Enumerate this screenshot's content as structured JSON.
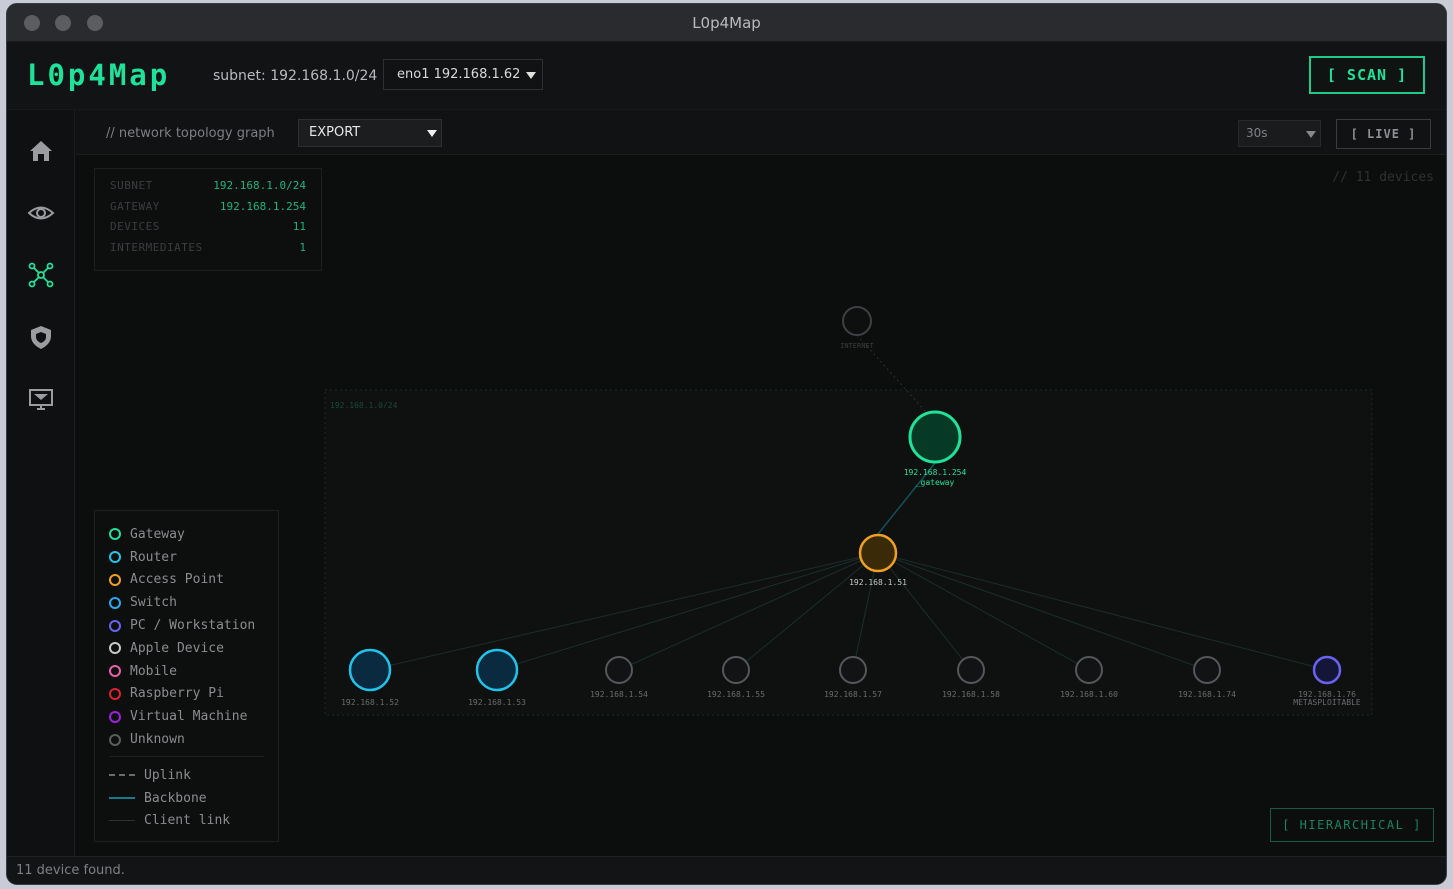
{
  "window": {
    "title": "L0p4Map"
  },
  "header": {
    "logo": "L0p4Map",
    "subnet_label": "subnet: 192.168.1.0/24",
    "interface": "eno1 192.168.1.62",
    "scan_button": "[ SCAN ]"
  },
  "sidebar": {
    "items": [
      {
        "icon": "home-icon",
        "active": false
      },
      {
        "icon": "eye-icon",
        "active": false
      },
      {
        "icon": "topology-icon",
        "active": true
      },
      {
        "icon": "shield-icon",
        "active": false
      },
      {
        "icon": "monitor-icon",
        "active": false
      }
    ]
  },
  "toolbar": {
    "label": "// network topology graph",
    "export": "EXPORT",
    "interval": "30s",
    "live_button": "[ LIVE ]"
  },
  "info": {
    "rows": [
      {
        "key": "SUBNET",
        "value": "192.168.1.0/24"
      },
      {
        "key": "GATEWAY",
        "value": "192.168.1.254"
      },
      {
        "key": "DEVICES",
        "value": "11"
      },
      {
        "key": "INTERMEDIATES",
        "value": "1"
      }
    ]
  },
  "device_count_label": "// 11 devices",
  "graph": {
    "subnet_box_label": "192.168.1.0/24",
    "internet": {
      "label": "INTERNET"
    },
    "gateway": {
      "ip": "192.168.1.254",
      "sub": "_gateway"
    },
    "access_point": {
      "ip": "192.168.1.51"
    },
    "devices": [
      {
        "ip": "192.168.1.52",
        "sub": "",
        "type": "router"
      },
      {
        "ip": "192.168.1.53",
        "sub": "",
        "type": "router"
      },
      {
        "ip": "192.168.1.54",
        "sub": "",
        "type": "unknown"
      },
      {
        "ip": "192.168.1.55",
        "sub": "",
        "type": "unknown"
      },
      {
        "ip": "192.168.1.57",
        "sub": "",
        "type": "unknown"
      },
      {
        "ip": "192.168.1.58",
        "sub": "",
        "type": "unknown"
      },
      {
        "ip": "192.168.1.60",
        "sub": "",
        "type": "unknown"
      },
      {
        "ip": "192.168.1.74",
        "sub": "",
        "type": "unknown"
      },
      {
        "ip": "192.168.1.76",
        "sub": "METASPLOITABLE",
        "type": "pc"
      }
    ]
  },
  "legend": {
    "types": [
      {
        "label": "Gateway",
        "color": "#1ee29a"
      },
      {
        "label": "Router",
        "color": "#22c3ea"
      },
      {
        "label": "Access Point",
        "color": "#f0a020"
      },
      {
        "label": "Switch",
        "color": "#2aa8f0"
      },
      {
        "label": "PC / Workstation",
        "color": "#6a62f0"
      },
      {
        "label": "Apple Device",
        "color": "#c8c8c8"
      },
      {
        "label": "Mobile",
        "color": "#e860a8"
      },
      {
        "label": "Raspberry Pi",
        "color": "#e02030"
      },
      {
        "label": "Virtual Machine",
        "color": "#a020e0"
      },
      {
        "label": "Unknown",
        "color": "#5a5c5f"
      }
    ],
    "links": [
      {
        "label": "Uplink",
        "style": "dashed",
        "color": "#6a6c70"
      },
      {
        "label": "Backbone",
        "style": "solid",
        "color": "#1a7a8a"
      },
      {
        "label": "Client link",
        "style": "thin",
        "color": "#2e3032"
      }
    ]
  },
  "hierarchical_button": "[ HIERARCHICAL ]",
  "status": "11 device found."
}
